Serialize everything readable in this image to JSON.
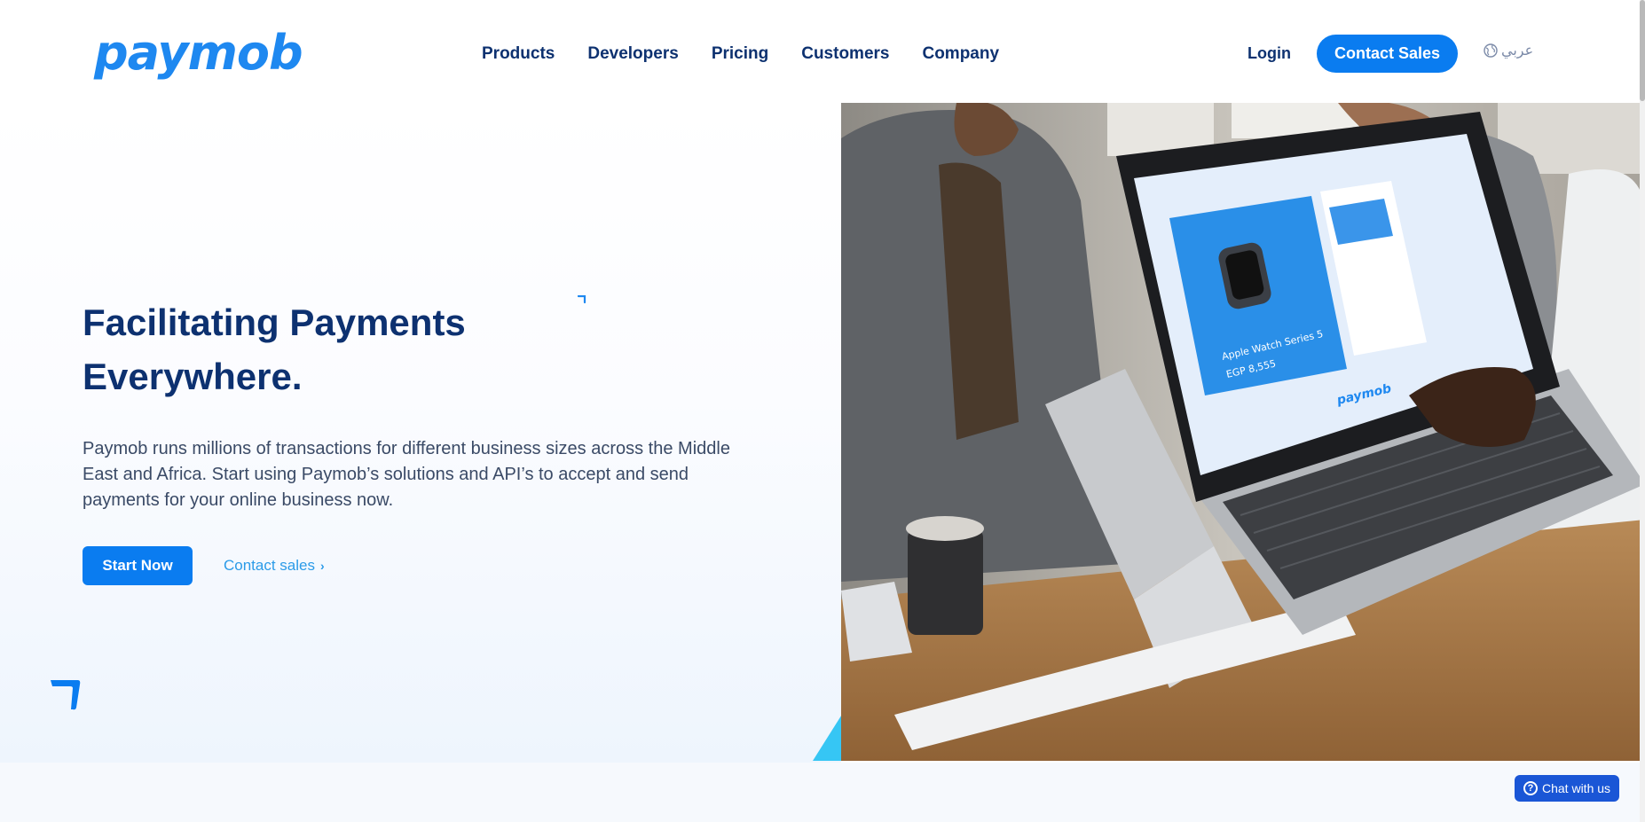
{
  "header": {
    "logo_text": "paymob",
    "nav": [
      "Products",
      "Developers",
      "Pricing",
      "Customers",
      "Company"
    ],
    "login_label": "Login",
    "contact_sales_label": "Contact Sales",
    "language_label": "عربي"
  },
  "hero": {
    "title_line1": "Facilitating Payments",
    "title_line2": "Everywhere.",
    "description": "Paymob runs millions of transactions for different business sizes across the Middle East and Africa. Start using Paymob’s solutions and API’s to accept and send payments for your online business now.",
    "start_button": "Start Now",
    "contact_link": "Contact sales",
    "contact_link_icon": "chevron-right-icon"
  },
  "hero_image": {
    "product_name": "Apple Watch Series 5",
    "price": "EGP 8,555",
    "brand_on_screen": "paymob"
  },
  "chat": {
    "label": "Chat with us",
    "icon": "question-circle-icon"
  },
  "colors": {
    "brand_blue": "#0a7cf0",
    "navy": "#0d3170",
    "link_blue": "#2b9be8",
    "chat_blue": "#1a56d6"
  }
}
